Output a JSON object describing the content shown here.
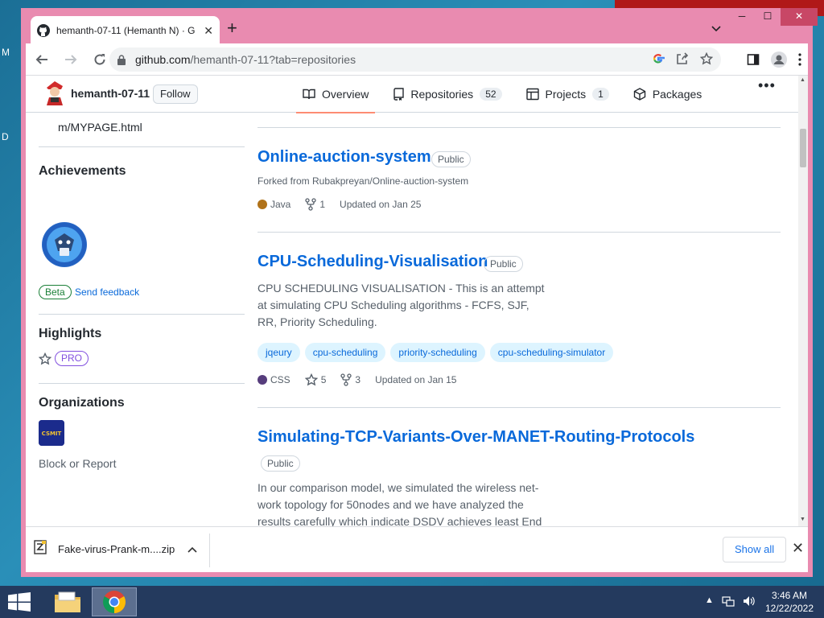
{
  "browser": {
    "tab_title": "hemanth-07-11 (Hemanth N) · G",
    "url_host": "github.com",
    "url_path": "/hemanth-07-11?tab=repositories"
  },
  "desktop": {
    "letter_m": "M",
    "letter_d": "D"
  },
  "profile": {
    "username": "hemanth-07-11",
    "follow_label": "Follow",
    "website_fragment": "m/MYPAGE.html",
    "achievements_heading": "Achievements",
    "beta_label": "Beta",
    "feedback_label": "Send feedback",
    "highlights_heading": "Highlights",
    "pro_label": "PRO",
    "organizations_heading": "Organizations",
    "org_logo_text": "CSMIT",
    "block_label": "Block or Report"
  },
  "nav": {
    "overview": "Overview",
    "repositories": "Repositories",
    "repositories_count": "52",
    "projects": "Projects",
    "projects_count": "1",
    "packages": "Packages"
  },
  "repos": [
    {
      "name": "Online-auction-system",
      "visibility": "Public",
      "forked_from": "Forked from Rubakpreyan/Online-auction-system",
      "language": "Java",
      "language_color": "#b07219",
      "forks": "1",
      "updated": "Updated on Jan 25"
    },
    {
      "name": "CPU-Scheduling-Visualisation",
      "visibility": "Public",
      "description": "CPU SCHEDULING VISUALISATION - This is an attempt at simulating CPU Scheduling algorithms - FCFS, SJF, RR, Priority Scheduling.",
      "topics": [
        "jqeury",
        "cpu-scheduling",
        "priority-scheduling",
        "cpu-scheduling-simulator"
      ],
      "language": "CSS",
      "language_color": "#563d7c",
      "stars": "5",
      "forks": "3",
      "updated": "Updated on Jan 15"
    },
    {
      "name": "Simulating-TCP-Variants-Over-MANET-Routing-Protocols",
      "visibility": "Public",
      "description": "In our comparison model, we simulated the wireless net-work topology for 50nodes and we have analyzed the results carefully which indicate DSDV achieves least End to"
    }
  ],
  "download": {
    "filename": "Fake-virus-Prank-m....zip",
    "show_all": "Show all"
  },
  "taskbar": {
    "time": "3:46 AM",
    "date": "12/22/2022"
  }
}
